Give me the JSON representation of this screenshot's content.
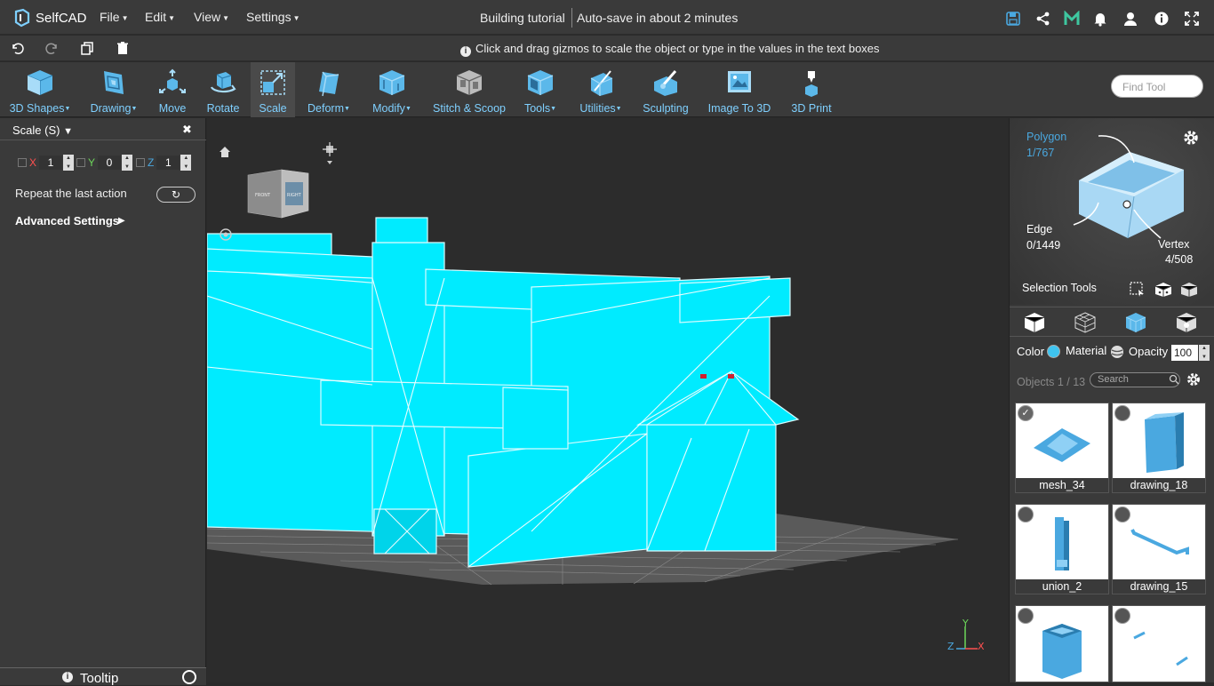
{
  "app": {
    "logo_text": "SelfCAD",
    "menus": [
      "File",
      "Edit",
      "View",
      "Settings"
    ],
    "document_title": "Building tutorial",
    "autosave": "Auto-save in about 2 minutes"
  },
  "hint": "Click and drag gizmos to scale the object or type in the values in the text boxes",
  "toolbar": {
    "tools": [
      {
        "label": "3D Shapes",
        "dropdown": true
      },
      {
        "label": "Drawing",
        "dropdown": true
      },
      {
        "label": "Move",
        "dropdown": false
      },
      {
        "label": "Rotate",
        "dropdown": false
      },
      {
        "label": "Scale",
        "dropdown": false,
        "active": true
      },
      {
        "label": "Deform",
        "dropdown": true
      },
      {
        "label": "Modify",
        "dropdown": true
      },
      {
        "label": "Stitch & Scoop",
        "dropdown": false
      },
      {
        "label": "Tools",
        "dropdown": true
      },
      {
        "label": "Utilities",
        "dropdown": true
      },
      {
        "label": "Sculpting",
        "dropdown": false
      },
      {
        "label": "Image To 3D",
        "dropdown": false
      },
      {
        "label": "3D Print",
        "dropdown": false
      }
    ],
    "find_placeholder": "Find Tool"
  },
  "scale_panel": {
    "title": "Scale (S)",
    "x_label": "X",
    "x_value": "1",
    "y_label": "Y",
    "y_value": "0",
    "z_label": "Z",
    "z_value": "1",
    "repeat_label": "Repeat the last action",
    "advanced_label": "Advanced Settings",
    "tooltip_label": "Tooltip"
  },
  "viewport": {
    "viewcube_front": "FRONT",
    "viewcube_right": "RIGHT",
    "axis_y": "Y",
    "axis_z": "Z",
    "axis_x": "X"
  },
  "selection": {
    "polygon_label": "Polygon",
    "polygon_count": "1/767",
    "edge_label": "Edge",
    "edge_count": "0/1449",
    "vertex_label": "Vertex",
    "vertex_count": "4/508",
    "tools_label": "Selection Tools"
  },
  "properties": {
    "color_label": "Color",
    "material_label": "Material",
    "opacity_label": "Opacity",
    "opacity_value": "100",
    "color_hex": "#3fc4f0"
  },
  "objects": {
    "count_label": "Objects 1 / 13",
    "search_placeholder": "Search",
    "items": [
      {
        "name": "mesh_34",
        "selected": true
      },
      {
        "name": "drawing_18",
        "selected": false
      },
      {
        "name": "union_2",
        "selected": false
      },
      {
        "name": "drawing_15",
        "selected": false
      },
      {
        "name": "",
        "selected": false
      },
      {
        "name": "",
        "selected": false
      }
    ]
  },
  "colors": {
    "accent": "#7fd0ff",
    "model": "#00ebff",
    "toolbar_bg": "#3a3a3a"
  }
}
